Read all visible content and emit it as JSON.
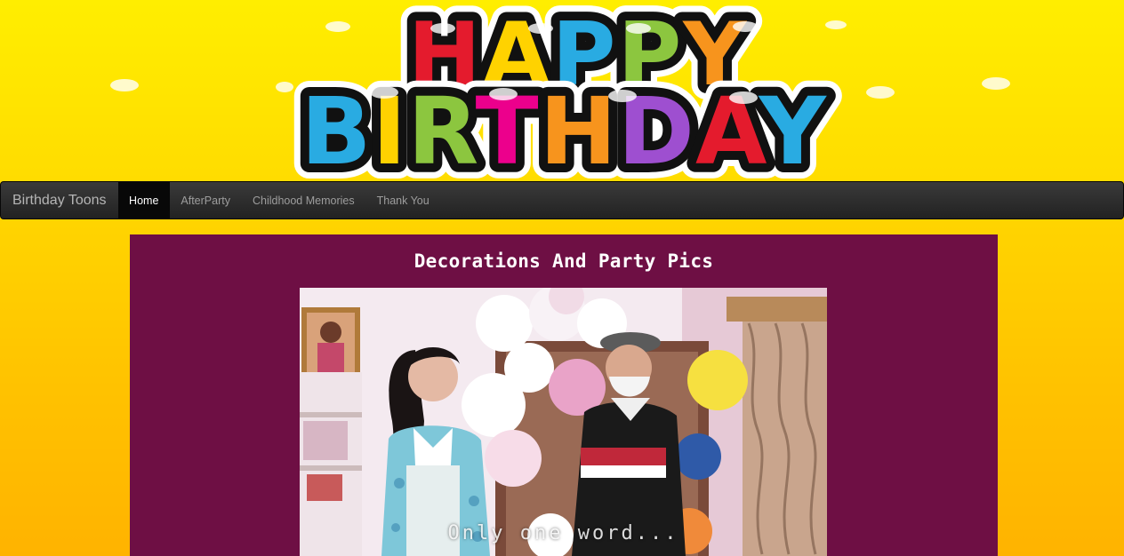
{
  "banner": {
    "line1": "HAPPY",
    "line2": "BIRTHDAY",
    "colors": [
      "#e41b2d",
      "#f7941d",
      "#ffd200",
      "#8cc63f",
      "#29abe2",
      "#ec008c",
      "#9e4fd0"
    ]
  },
  "navbar": {
    "brand": "Birthday Toons",
    "items": [
      {
        "label": "Home",
        "active": true
      },
      {
        "label": "AfterParty",
        "active": false
      },
      {
        "label": "Childhood Memories",
        "active": false
      },
      {
        "label": "Thank You",
        "active": false
      }
    ]
  },
  "main": {
    "title": "Decorations And Party Pics",
    "photo": {
      "caption": "Only one word..."
    }
  }
}
